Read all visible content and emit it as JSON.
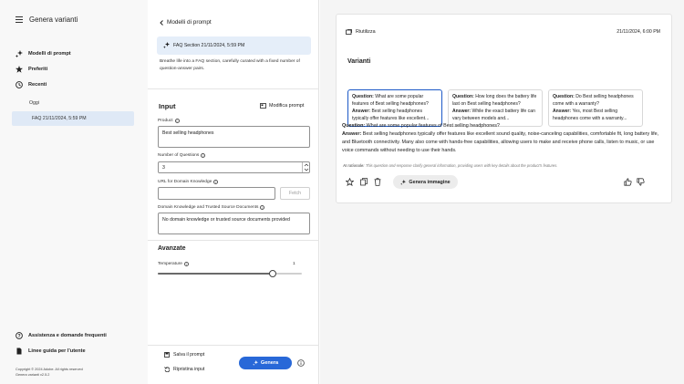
{
  "app": {
    "title": "Genera varianti"
  },
  "sidebar": {
    "items": [
      {
        "label": "Modelli di prompt"
      },
      {
        "label": "Preferiti"
      },
      {
        "label": "Recenti"
      }
    ],
    "recent_group": "Oggi",
    "recent_item": "FAQ 21/11/2024, 5:59 PM",
    "help": "Assistenza e domande frequenti",
    "guidelines": "Linee guida per l'utente",
    "copyright": "Copyright © 2024 Adobe. All rights reserved",
    "version": "Genera varianti v2.5.2"
  },
  "form": {
    "back_label": "Modelli di prompt",
    "template_title": "FAQ Section 21/11/2024, 5:59 PM",
    "template_desc": "Breathe life into a FAQ section, carefully curated with a fixed number of question-answer pairs.",
    "input_heading": "Input",
    "edit_prompt": "Modifica prompt",
    "product_label": "Product",
    "product_value": "Best selling headphones",
    "questions_label": "Number of Questions",
    "questions_value": "3",
    "url_label": "URL for Domain Knowledge",
    "url_value": "",
    "fetch_label": "Fetch",
    "domain_label": "Domain Knowledge and Trusted Source Documents",
    "domain_value": "No domain knowledge or trusted source documents provided",
    "advanced_heading": "Avanzate",
    "temperature_label": "Temperature",
    "temperature_value": "1",
    "temperature_fraction": 0.8,
    "save_prompt": "Salva il prompt",
    "reset_input": "Ripristina input",
    "generate": "Genera"
  },
  "result": {
    "reuse_label": "Riutilizza",
    "timestamp": "21/11/2024, 6:00 PM",
    "variants_heading": "Varianti",
    "variants": [
      {
        "q": "What are some popular features of Best selling headphones?",
        "a": "Best selling headphones typically offer features like excellent...",
        "selected": true
      },
      {
        "q": "How long does the battery life last on Best selling headphones?",
        "a": "While the exact battery life can vary between models and...",
        "selected": false
      },
      {
        "q": "Do Best selling headphones come with a warranty?",
        "a": "Yes, most Best selling headphones come with a warranty...",
        "selected": false
      }
    ],
    "question_label": "Question:",
    "answer_label": "Answer:",
    "detail_question": "What are some popular features of Best selling headphones?",
    "detail_answer": "Best selling headphones typically offer features like excellent sound quality, noise-canceling capabilities, comfortable fit, long battery life, and Bluetooth connectivity. Many also come with hands-free capabilities, allowing users to make and receive phone calls, listen to music, or use voice commands without needing to use their hands.",
    "rationale_label": "AI rationale:",
    "rationale_text": "This question-and-response clarify general information, providing users with key details about the product's features.",
    "generate_image": "Genera immagine"
  },
  "colors": {
    "accent": "#2868d8",
    "selected_bg": "#dfe9f6"
  }
}
